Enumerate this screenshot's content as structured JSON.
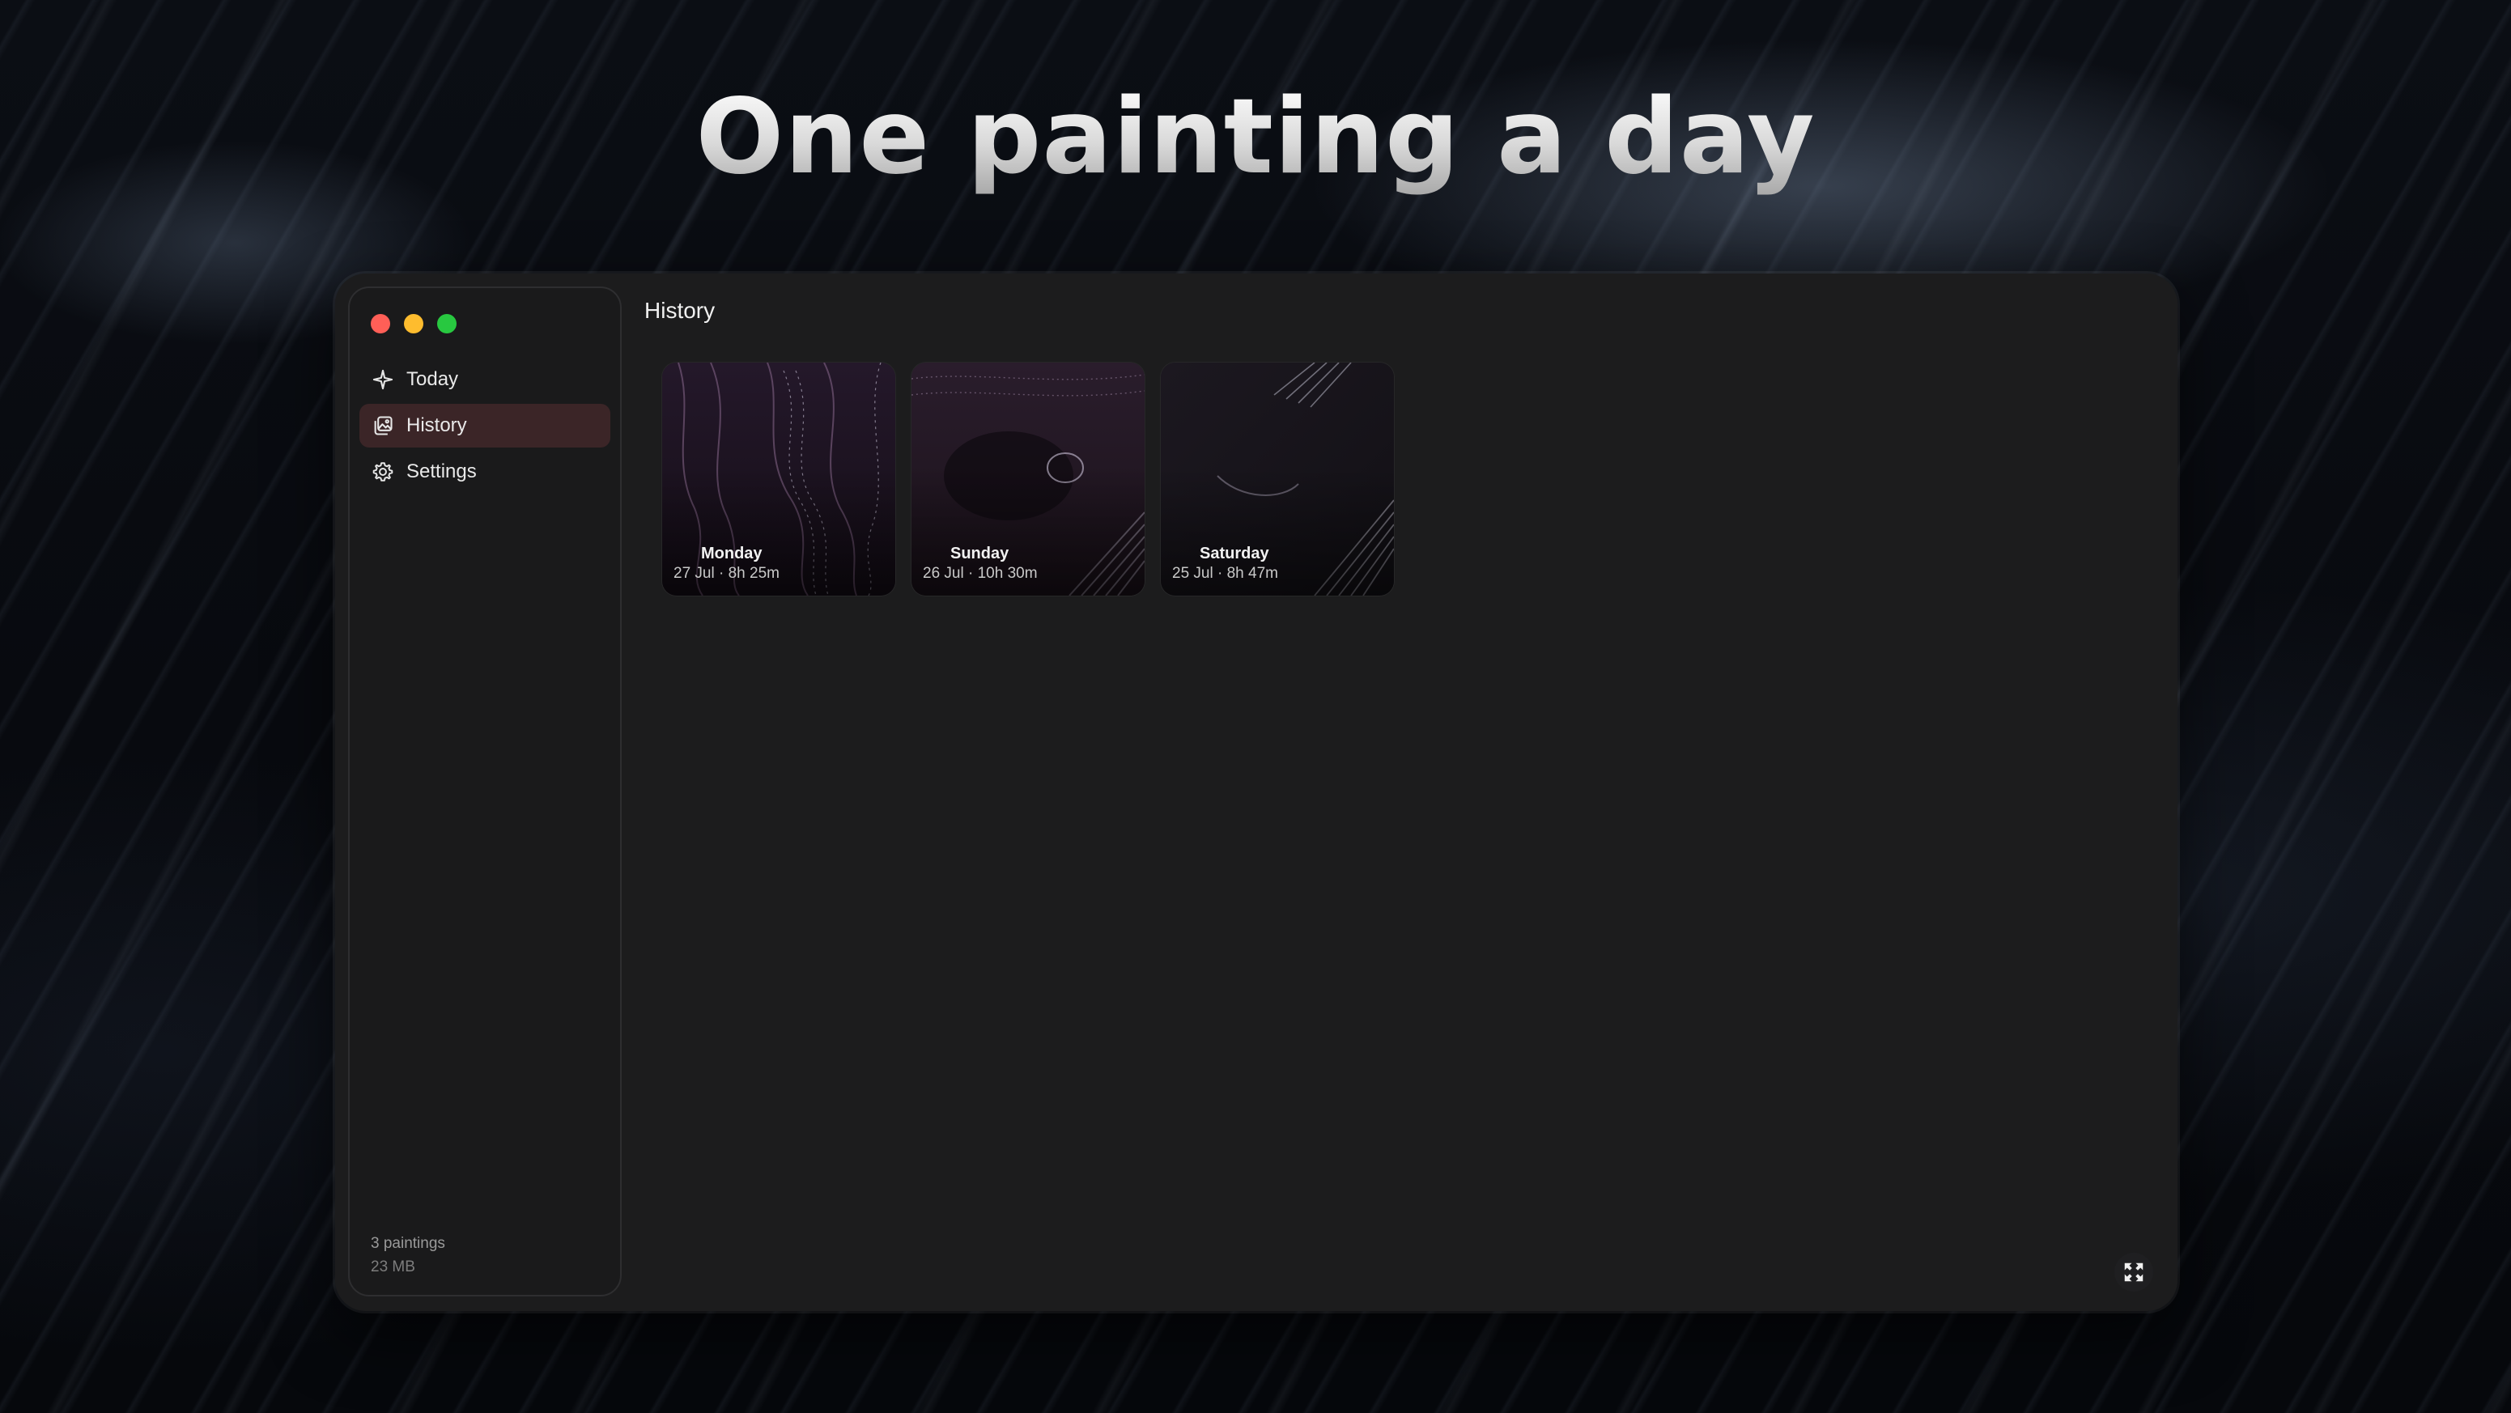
{
  "hero": {
    "headline": "One painting a day"
  },
  "window": {
    "traffic_lights": [
      "close",
      "minimize",
      "zoom"
    ],
    "sidebar": {
      "items": [
        {
          "label": "Today",
          "icon": "sparkle-icon",
          "active": false
        },
        {
          "label": "History",
          "icon": "gallery-icon",
          "active": true
        },
        {
          "label": "Settings",
          "icon": "gear-icon",
          "active": false
        }
      ],
      "footer": {
        "count": "3 paintings",
        "size": "23 MB"
      }
    },
    "content": {
      "title": "History",
      "paintings": [
        {
          "day": "Monday",
          "meta": "27 Jul · 8h 25m"
        },
        {
          "day": "Sunday",
          "meta": "26 Jul · 10h 30m"
        },
        {
          "day": "Saturday",
          "meta": "25 Jul · 8h 47m"
        }
      ]
    },
    "fullscreen_icon": "expand-icon"
  },
  "colors": {
    "window_bg": "#1c1c1d",
    "active_item": "#3b2527",
    "close": "#ff5f57",
    "minimize": "#febc2e",
    "zoom": "#28c840"
  }
}
